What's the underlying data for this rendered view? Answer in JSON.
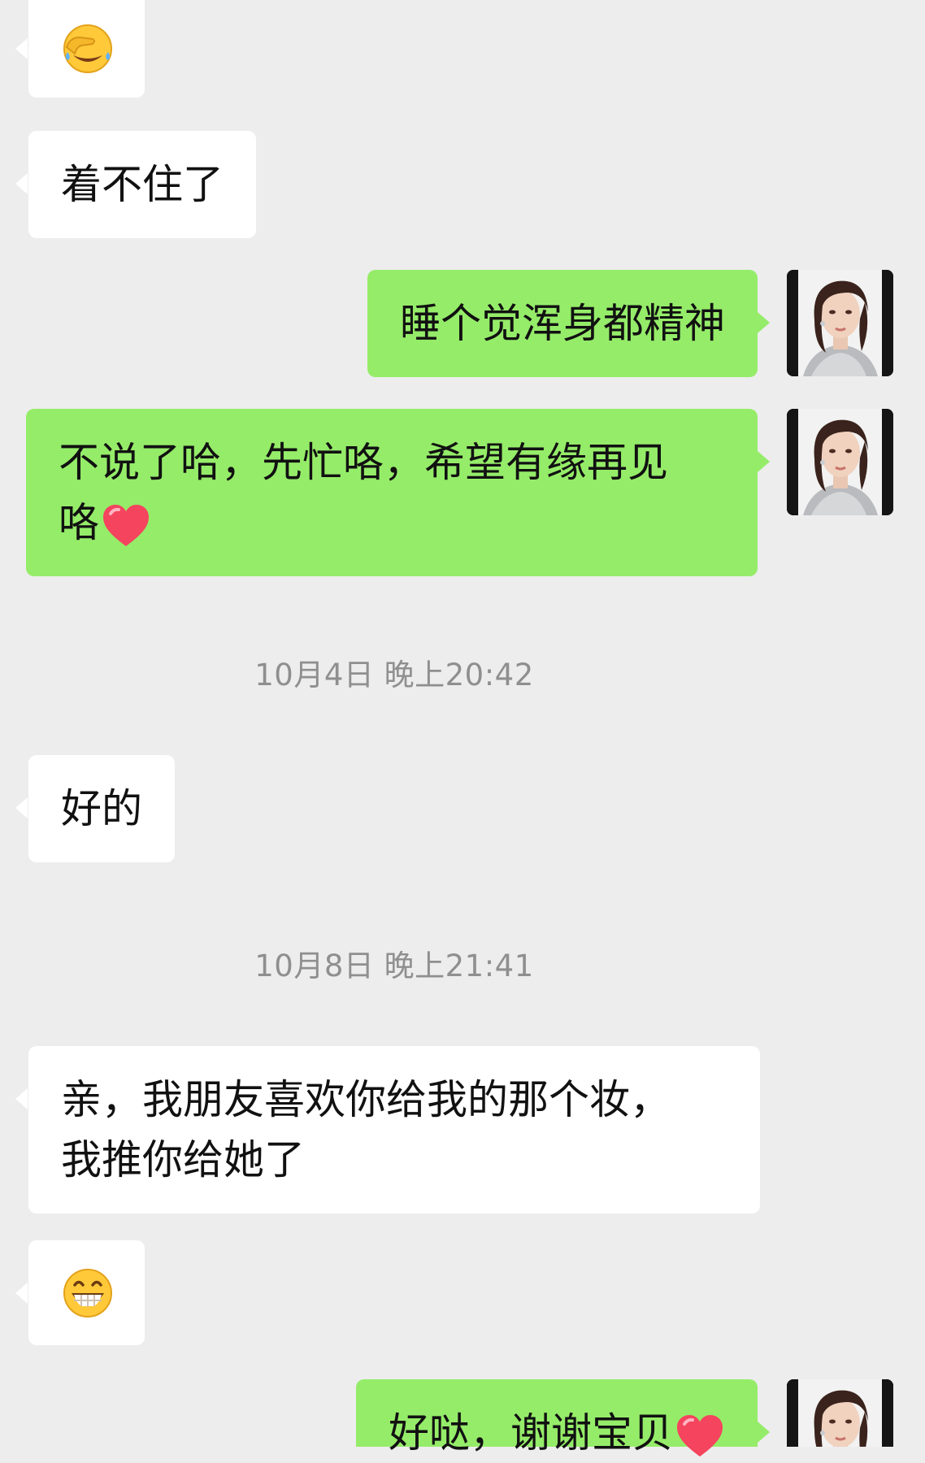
{
  "messages": {
    "m1": {
      "emoji": "facepalm-tears-emoji"
    },
    "m2": {
      "text": "着不住了"
    },
    "m3": {
      "text": "睡个觉浑身都精神"
    },
    "m4": {
      "line1": "不说了哈，先忙咯，希望有缘再见",
      "line2": "咯",
      "emoji": "red-heart-emoji"
    },
    "ts1": {
      "text": "10月4日 晚上20:42"
    },
    "m5": {
      "text": "好的"
    },
    "ts2": {
      "text": "10月8日 晚上21:41"
    },
    "m6": {
      "line1": "亲，我朋友喜欢你给我的那个妆，",
      "line2": "我推你给她了"
    },
    "m7": {
      "emoji": "grinning-emoji"
    },
    "m8": {
      "text": "好哒，谢谢宝贝",
      "emoji": "red-heart-emoji"
    }
  },
  "colors": {
    "background": "#ededed",
    "incoming_bubble": "#ffffff",
    "outgoing_bubble": "#95ec69",
    "timestamp_text": "#8f8f8f"
  }
}
